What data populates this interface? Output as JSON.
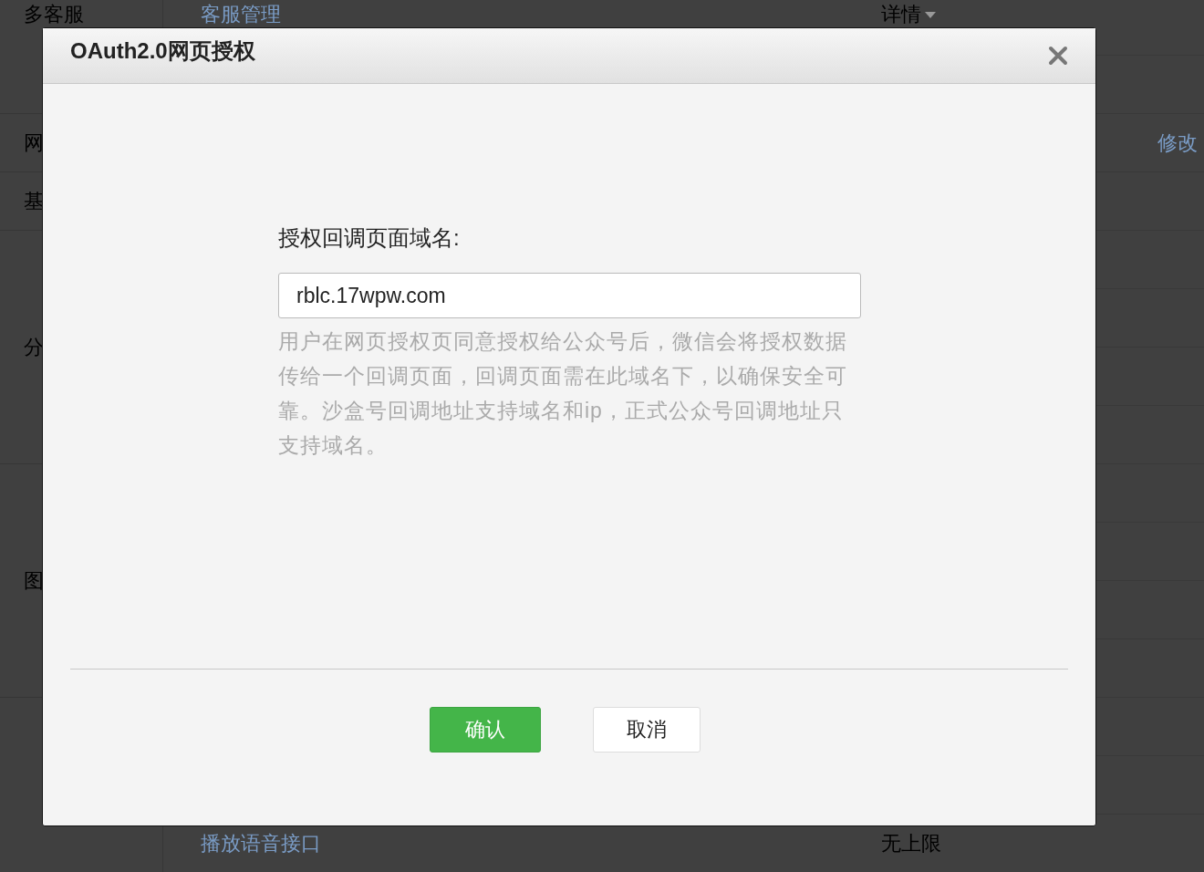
{
  "background_table": {
    "sections": [
      {
        "label": "多客服",
        "rows": [
          {
            "name": "客服管理",
            "detail": "详情"
          }
        ]
      },
      {
        "label": "网",
        "rows": [
          {
            "action": "修改"
          }
        ]
      },
      {
        "label": "基"
      },
      {
        "label": "分"
      },
      {
        "label": "图"
      },
      {
        "rows": [
          {
            "name": "播放语音接口",
            "limit": "无上限"
          }
        ]
      }
    ]
  },
  "dialog": {
    "title": "OAuth2.0网页授权",
    "field": {
      "label": "授权回调页面域名:",
      "value": "rblc.17wpw.com"
    },
    "help_text": "用户在网页授权页同意授权给公众号后，微信会将授权数据传给一个回调页面，回调页面需在此域名下，以确保安全可靠。沙盒号回调地址支持域名和ip，正式公众号回调地址只支持域名。",
    "buttons": [
      {
        "label": "确认",
        "kind": "primary"
      },
      {
        "label": "取消",
        "kind": "secondary"
      }
    ]
  }
}
